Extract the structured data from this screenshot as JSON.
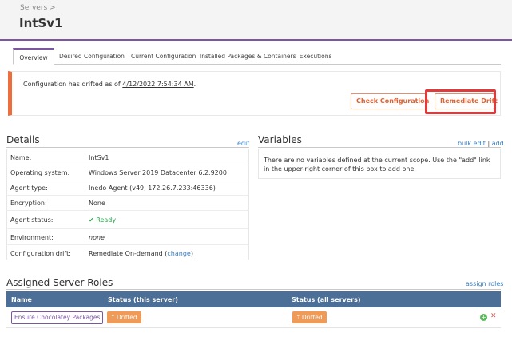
{
  "breadcrumb": "Servers >",
  "title": "IntSv1",
  "tabs": [
    {
      "label": "Overview"
    },
    {
      "label": "Desired Configuration"
    },
    {
      "label": "Current Configuration"
    },
    {
      "label": "Installed Packages & Containers"
    },
    {
      "label": "Executions"
    }
  ],
  "alert": {
    "text_prefix": "Configuration has drifted as of ",
    "date": "4/12/2022 7:54:34 AM",
    "text_suffix": ".",
    "check_button": "Check Configuration",
    "remediate_button": "Remediate Drift"
  },
  "details": {
    "title": "Details",
    "edit_link": "edit",
    "rows": [
      {
        "key": "Name:",
        "value": "IntSv1"
      },
      {
        "key": "Operating system:",
        "value": "Windows Server 2019 Datacenter 6.2.9200"
      },
      {
        "key": "Agent type:",
        "value": "Inedo Agent (v49, 172.26.7.233:46336)"
      },
      {
        "key": "Encryption:",
        "value": "None"
      },
      {
        "key": "Agent status:",
        "value": "Ready"
      },
      {
        "key": "Environment:",
        "value": "none"
      },
      {
        "key": "Configuration drift:",
        "value": "Remediate On-demand (",
        "link": "change",
        "suffix": ")"
      }
    ]
  },
  "variables": {
    "title": "Variables",
    "bulk_edit": "bulk edit",
    "separator": "|",
    "add": "add",
    "empty_text": "There are no variables defined at the current scope. Use the \"add\" link in the upper-right corner of this box to add one."
  },
  "roles": {
    "title": "Assigned Server Roles",
    "assign_link": "assign roles",
    "columns": [
      "Name",
      "Status (this server)",
      "Status (all servers)"
    ],
    "rows": [
      {
        "name": "Ensure Chocolatey Packages",
        "status_this": "Drifted",
        "status_all": "Drifted"
      }
    ]
  },
  "colors": {
    "accent": "#7e55a3",
    "alert": "#ef6d3b",
    "highlight": "#e23a3a",
    "table_header": "#4b6f97",
    "drift": "#ef9a56",
    "ready": "#2a9d4a"
  },
  "icons": {
    "ready": "check-icon",
    "drift": "branch-icon",
    "add": "plus-circle-icon",
    "remove": "x-icon"
  }
}
